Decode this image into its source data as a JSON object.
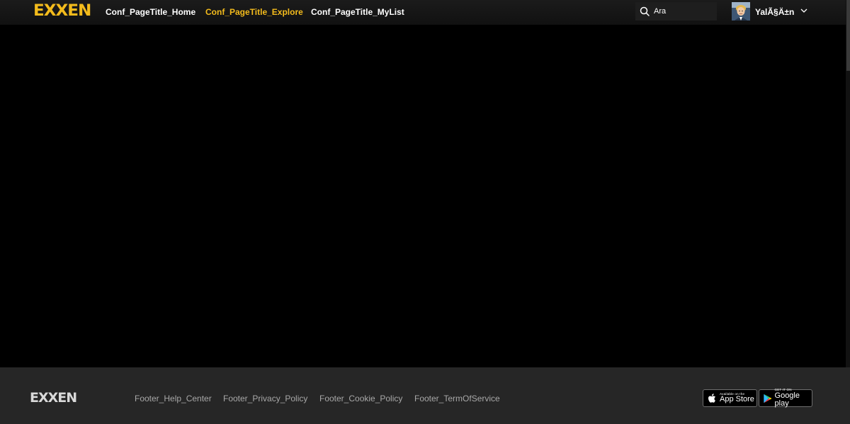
{
  "header": {
    "logo": "EXXEN",
    "nav": [
      {
        "label": "Conf_PageTitle_Home",
        "active": false
      },
      {
        "label": "Conf_PageTitle_Explore",
        "active": true
      },
      {
        "label": "Conf_PageTitle_MyList",
        "active": false
      }
    ],
    "search": {
      "placeholder": "Ara",
      "value": ""
    },
    "user": {
      "name": "YalÃ§Ä±n"
    }
  },
  "footer": {
    "logo": "EXXEN",
    "links": [
      "Footer_Help_Center",
      "Footer_Privacy_Policy",
      "Footer_Cookie_Policy",
      "Footer_TermOfService"
    ],
    "app_store": {
      "small": "Available on the",
      "big": "App Store"
    },
    "google_play": {
      "small": "GET IT ON",
      "big": "Google play"
    }
  },
  "colors": {
    "brand": "#f3bb1c",
    "header_bg": "#161616",
    "footer_bg": "#262626",
    "main_bg": "#000000"
  },
  "icons": [
    "search-icon",
    "chevron-down-icon",
    "apple-icon",
    "google-play-icon"
  ]
}
